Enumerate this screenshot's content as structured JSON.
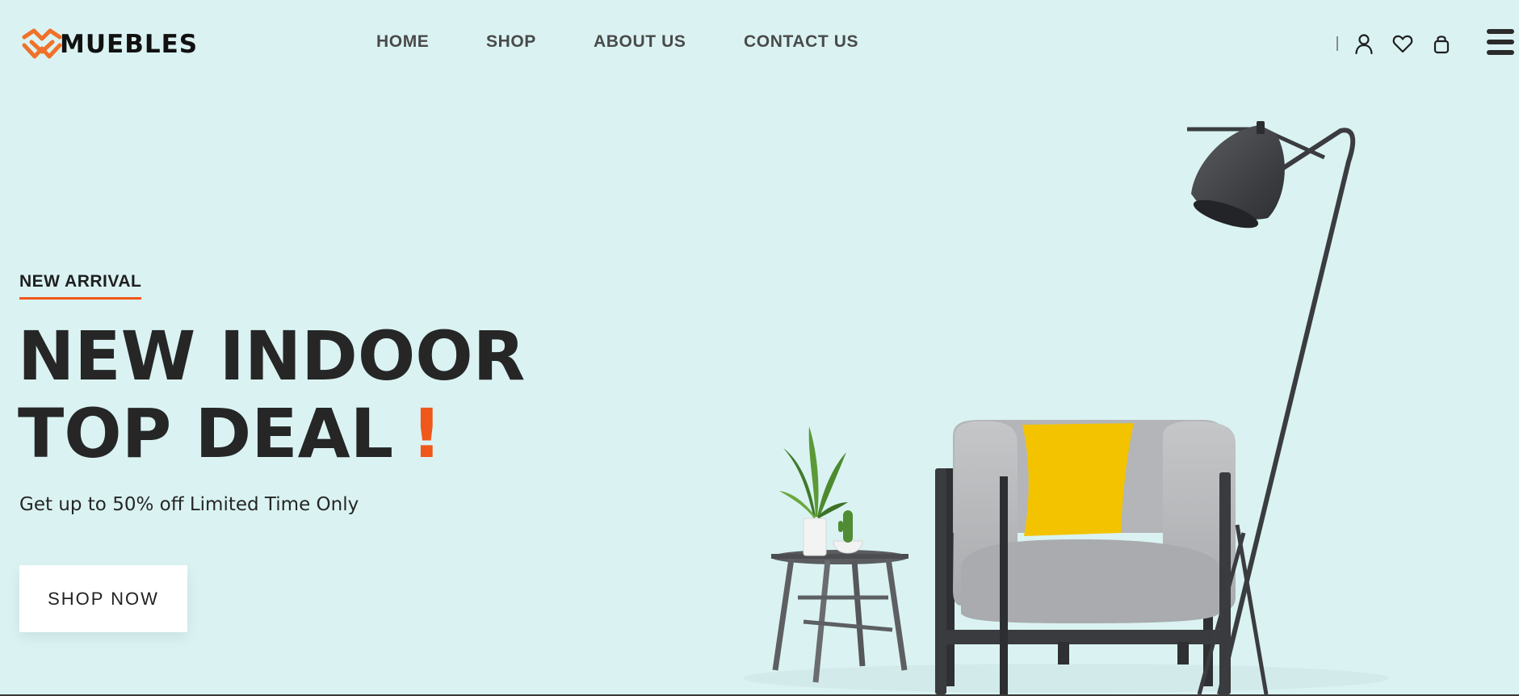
{
  "header": {
    "brand": "MUEBLES",
    "nav": [
      {
        "label": "HOME"
      },
      {
        "label": "SHOP"
      },
      {
        "label": "ABOUT US"
      },
      {
        "label": "CONTACT US"
      }
    ],
    "icons": [
      "user-icon",
      "heart-icon",
      "bag-icon",
      "menu-icon"
    ]
  },
  "hero": {
    "eyebrow": "NEW ARRIVAL",
    "headline_line1": "NEW INDOOR",
    "headline_line2": "TOP DEAL",
    "headline_accent": "!",
    "subtext": "Get up to 50% off Limited Time Only",
    "cta_label": "SHOP NOW"
  },
  "colors": {
    "background": "#daf3f2",
    "accent": "#f0571a",
    "text": "#262626",
    "pillow": "#f3c300",
    "armchair": "#b9bbbd",
    "metal": "#3e3f42"
  }
}
